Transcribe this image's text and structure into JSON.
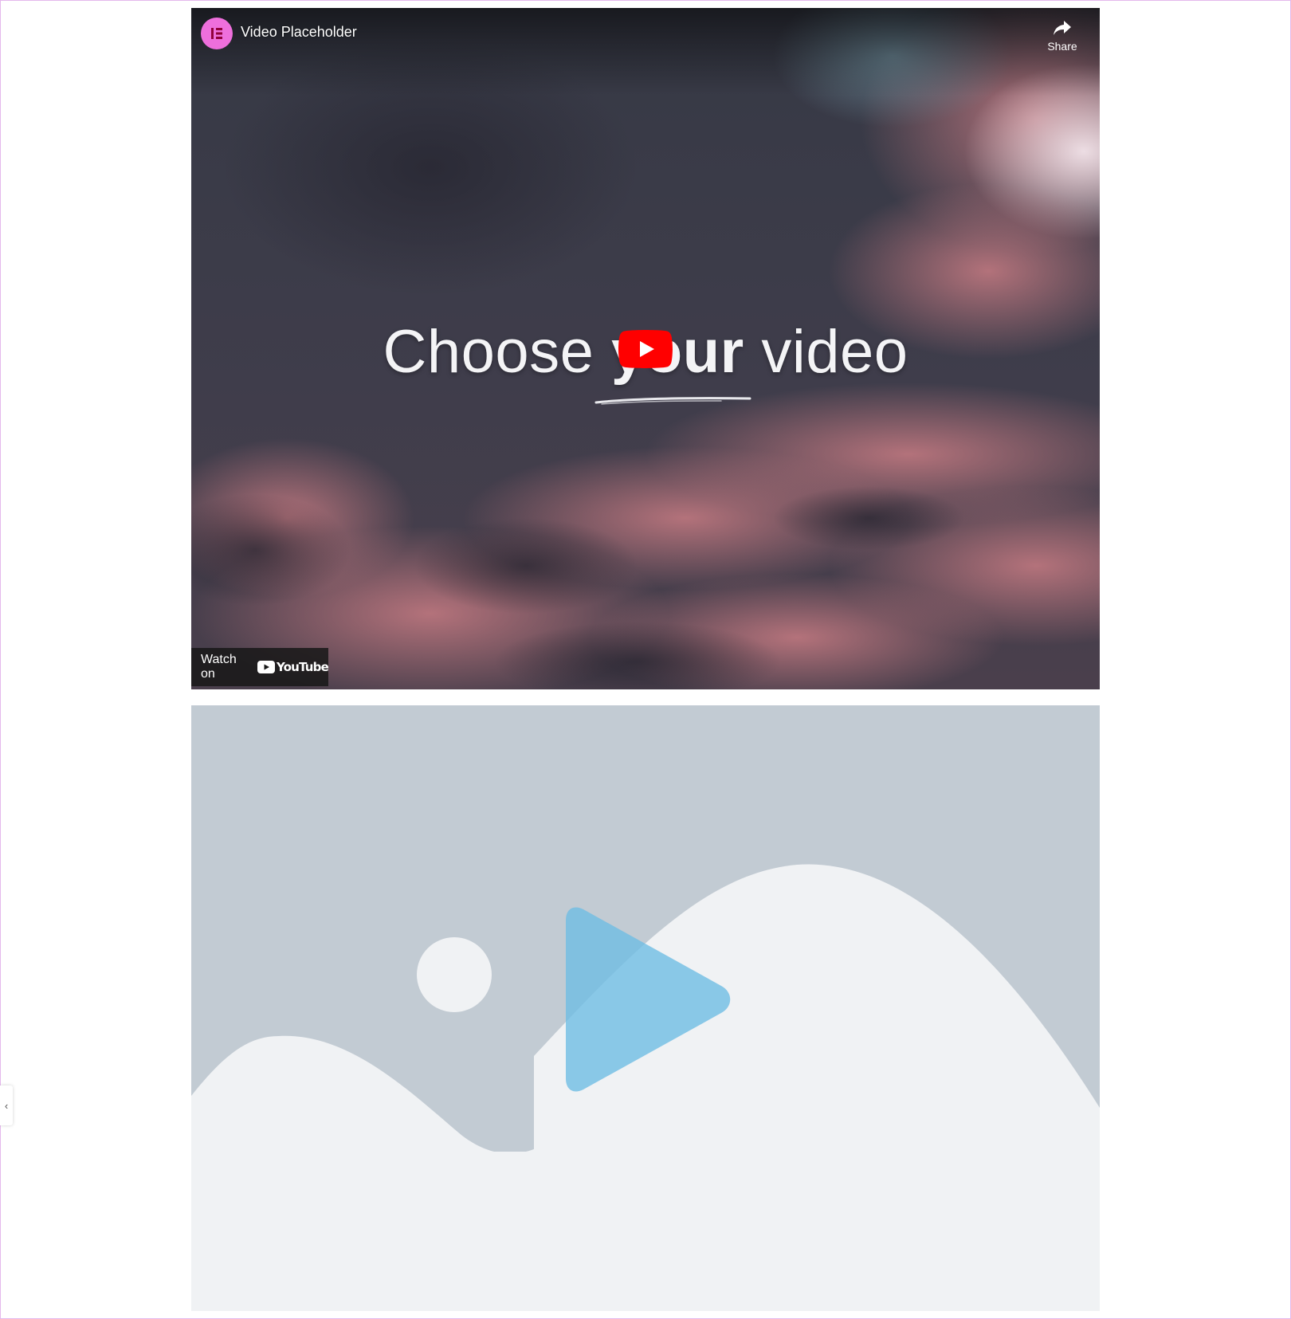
{
  "youtube_embed": {
    "video_title": "Video Placeholder",
    "share_label": "Share",
    "headline_parts": [
      "Choose ",
      "your",
      " video"
    ],
    "watch_on_label": "Watch on",
    "youtube_wordmark": "YouTube",
    "channel_icon": "elementor-logo-icon",
    "play_icon": "youtube-play-icon",
    "share_icon": "share-arrow-icon"
  },
  "video_placeholder": {
    "icon": "play-icon",
    "illustration": "mountains-and-sun-placeholder"
  },
  "side_panel_toggle": {
    "label": "‹",
    "icon": "chevron-left-icon"
  },
  "colors": {
    "channel_avatar": "#ee6fdc",
    "youtube_red": "#ff0000",
    "placeholder_sky": "#c2cbd3",
    "placeholder_land": "#f0f2f4",
    "placeholder_play": "#6fbde3"
  }
}
